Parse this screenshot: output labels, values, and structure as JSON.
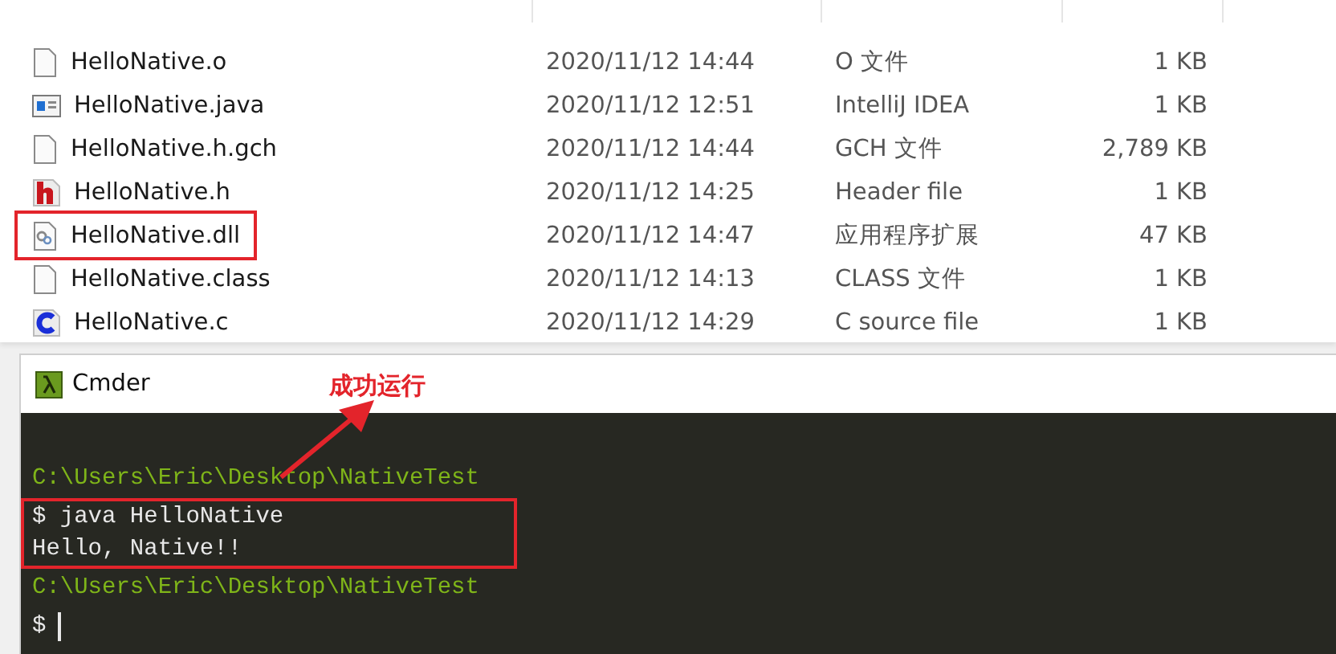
{
  "files": [
    {
      "name": "HelloNative.o",
      "kind": "blank",
      "date": "2020/11/12 14:44",
      "type": "O 文件",
      "size": "1 KB",
      "highlighted": false
    },
    {
      "name": "HelloNative.java",
      "kind": "java",
      "date": "2020/11/12 12:51",
      "type": "IntelliJ IDEA",
      "size": "1 KB",
      "highlighted": false
    },
    {
      "name": "HelloNative.h.gch",
      "kind": "blank",
      "date": "2020/11/12 14:44",
      "type": "GCH 文件",
      "size": "2,789 KB",
      "highlighted": false
    },
    {
      "name": "HelloNative.h",
      "kind": "h",
      "date": "2020/11/12 14:25",
      "type": "Header file",
      "size": "1 KB",
      "highlighted": false
    },
    {
      "name": "HelloNative.dll",
      "kind": "dll",
      "date": "2020/11/12 14:47",
      "type": "应用程序扩展",
      "size": "47 KB",
      "highlighted": true
    },
    {
      "name": "HelloNative.class",
      "kind": "blank",
      "date": "2020/11/12 14:13",
      "type": "CLASS 文件",
      "size": "1 KB",
      "highlighted": false
    },
    {
      "name": "HelloNative.c",
      "kind": "c",
      "date": "2020/11/12 14:29",
      "type": "C source file",
      "size": "1 KB",
      "highlighted": false
    }
  ],
  "terminal": {
    "title": "Cmder",
    "annotation": "成功运行",
    "lines": [
      {
        "kind": "prompt",
        "text": "C:\\Users\\Eric\\Desktop\\NativeTest",
        "highlighted": false
      },
      {
        "kind": "command",
        "text": "$ java HelloNative",
        "highlighted": true
      },
      {
        "kind": "output",
        "text": "Hello, Native!!",
        "highlighted": true
      },
      {
        "kind": "prompt",
        "text": "C:\\Users\\Eric\\Desktop\\NativeTest",
        "highlighted": false
      },
      {
        "kind": "cursor",
        "text": "$",
        "highlighted": false
      }
    ]
  }
}
